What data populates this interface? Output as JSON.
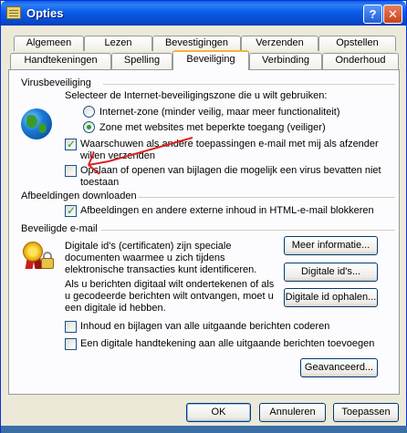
{
  "window": {
    "title": "Opties"
  },
  "tabs_row1": [
    "Algemeen",
    "Lezen",
    "Bevestigingen",
    "Verzenden",
    "Opstellen"
  ],
  "tabs_row2": [
    "Handtekeningen",
    "Spelling",
    "Beveiliging",
    "Verbinding",
    "Onderhoud"
  ],
  "active_tab": "Beveiliging",
  "virus": {
    "heading": "Virusbeveiliging",
    "zone_prompt": "Selecteer de Internet-beveiligingszone die u wilt gebruiken:",
    "radio_internet": "Internet-zone (minder veilig, maar meer functionaliteit)",
    "radio_restricted": "Zone met websites met beperkte toegang (veiliger)",
    "warn_line1": "Waarschuwen als andere toepassingen e-mail met mij als afzender",
    "warn_line2": "willen verzenden",
    "attach_line1": "Opslaan of openen van bijlagen die mogelijk een virus bevatten niet",
    "attach_line2": "toestaan"
  },
  "images": {
    "heading": "Afbeeldingen downloaden",
    "block_label": "Afbeeldingen en andere externe inhoud in HTML-e-mail blokkeren"
  },
  "secure": {
    "heading": "Beveiligde e-mail",
    "desc1_l1": "Digitale id's (certificaten) zijn speciale",
    "desc1_l2": "documenten waarmee u zich tijdens",
    "desc1_l3": "elektronische transacties kunt identificeren.",
    "desc2_l1": "Als u berichten digitaal wilt ondertekenen of als",
    "desc2_l2": "u gecodeerde berichten wilt ontvangen, moet u",
    "desc2_l3": "een digitale id hebben.",
    "btn_more": "Meer informatie...",
    "btn_ids": "Digitale id's...",
    "btn_get": "Digitale id ophalen...",
    "encrypt_label": "Inhoud en bijlagen van alle uitgaande berichten coderen",
    "sign_label": "Een digitale handtekening aan alle uitgaande berichten toevoegen",
    "btn_advanced": "Geavanceerd..."
  },
  "footer": {
    "ok": "OK",
    "cancel": "Annuleren",
    "apply": "Toepassen"
  },
  "state": {
    "radio_selected": "restricted",
    "warn_checked": true,
    "attach_checked": false,
    "block_images_checked": true,
    "encrypt_checked": false,
    "sign_checked": false
  },
  "annotation": {
    "color": "#e02020"
  }
}
